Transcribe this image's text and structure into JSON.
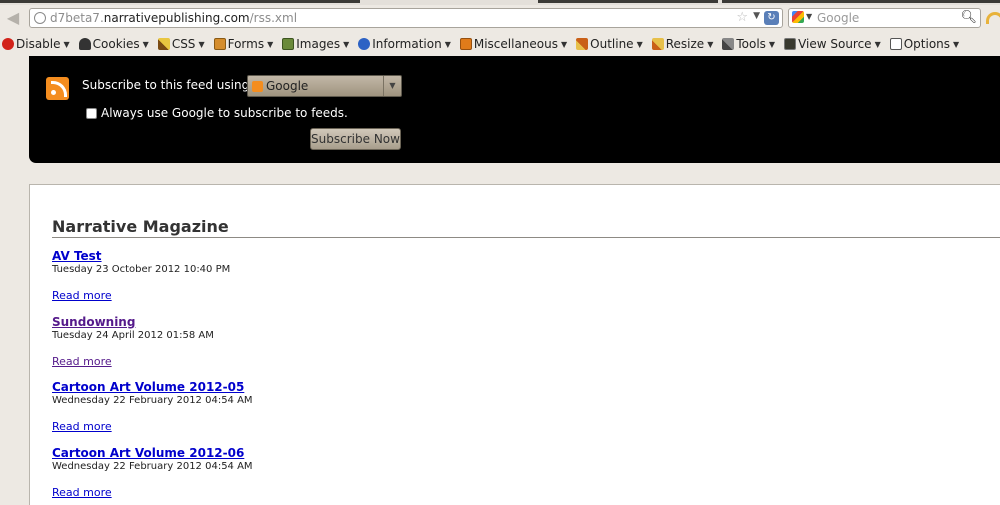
{
  "browser": {
    "url_prefix": "d7beta7.",
    "url_domain": "narrativepublishing.com",
    "url_suffix": "/rss.xml",
    "search_placeholder": "Google"
  },
  "devtoolbar": {
    "items": [
      {
        "label": "Disable",
        "icon": "disable-icon"
      },
      {
        "label": "Cookies",
        "icon": "cookies-icon"
      },
      {
        "label": "CSS",
        "icon": "css-icon"
      },
      {
        "label": "Forms",
        "icon": "forms-icon"
      },
      {
        "label": "Images",
        "icon": "images-icon"
      },
      {
        "label": "Information",
        "icon": "information-icon"
      },
      {
        "label": "Miscellaneous",
        "icon": "miscellaneous-icon"
      },
      {
        "label": "Outline",
        "icon": "outline-icon"
      },
      {
        "label": "Resize",
        "icon": "resize-icon"
      },
      {
        "label": "Tools",
        "icon": "tools-icon"
      },
      {
        "label": "View Source",
        "icon": "view-source-icon"
      },
      {
        "label": "Options",
        "icon": "options-icon"
      }
    ]
  },
  "subscribe": {
    "using_label": "Subscribe to this feed using",
    "reader_selected": "Google",
    "always_label": "Always use Google to subscribe to feeds.",
    "always_checked": false,
    "button_label": "Subscribe Now"
  },
  "feed": {
    "title": "Narrative Magazine",
    "entries": [
      {
        "title": "AV Test",
        "date": "Tuesday 23 October 2012 10:40 PM",
        "read_more": "Read more",
        "visited": false
      },
      {
        "title": "Sundowning",
        "date": "Tuesday 24 April 2012 01:58 AM",
        "read_more": "Read more",
        "visited": true
      },
      {
        "title": "Cartoon Art Volume 2012-05",
        "date": "Wednesday 22 February 2012 04:54 AM",
        "read_more": "Read more",
        "visited": false
      },
      {
        "title": "Cartoon Art Volume 2012-06",
        "date": "Wednesday 22 February 2012 04:54 AM",
        "read_more": "Read more",
        "visited": false
      }
    ]
  },
  "colors": {
    "link": "#0000cc",
    "visited_link": "#551a8b",
    "rss_orange": "#f48d1f",
    "panel_black": "#000000"
  }
}
